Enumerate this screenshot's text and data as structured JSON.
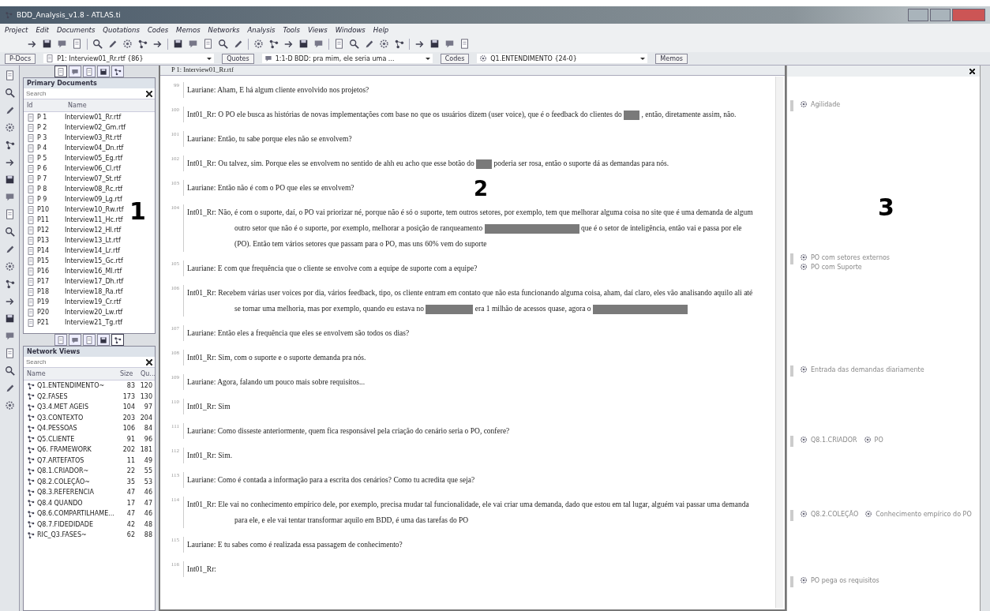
{
  "window": {
    "title": "BDD_Analysis_v1.8 - ATLAS.ti",
    "menu": [
      "Project",
      "Edit",
      "Documents",
      "Quotations",
      "Codes",
      "Memos",
      "Networks",
      "Analysis",
      "Tools",
      "Views",
      "Windows",
      "Help"
    ]
  },
  "selector_bar": [
    {
      "kind": "button",
      "label": "P-Docs"
    },
    {
      "kind": "combo",
      "value": "P1: Interview01_Rr.rtf {86}"
    },
    {
      "kind": "button",
      "label": "Quotes"
    },
    {
      "kind": "combo",
      "value": "1:1-D BDD: pra mim, ele seria uma ..."
    },
    {
      "kind": "button",
      "label": "Codes"
    },
    {
      "kind": "combo",
      "value": "Q1.ENTENDIMENTO {24-0}"
    },
    {
      "kind": "button",
      "label": "Memos"
    }
  ],
  "primary_documents": {
    "title": "Primary Documents",
    "search_placeholder": "Search",
    "columns": [
      "Id",
      "Name"
    ],
    "rows": [
      {
        "id": "P 1",
        "name": "Interview01_Rr.rtf"
      },
      {
        "id": "P 2",
        "name": "Interview02_Gm.rtf"
      },
      {
        "id": "P 3",
        "name": "Interview03_Rt.rtf"
      },
      {
        "id": "P 4",
        "name": "Interview04_Dn.rtf"
      },
      {
        "id": "P 5",
        "name": "Interview05_Eg.rtf"
      },
      {
        "id": "P 6",
        "name": "Interview06_Cl.rtf"
      },
      {
        "id": "P 7",
        "name": "Interview07_St.rtf"
      },
      {
        "id": "P 8",
        "name": "Interview08_Rc.rtf"
      },
      {
        "id": "P 9",
        "name": "Interview09_Lg.rtf"
      },
      {
        "id": "P10",
        "name": "Interview10_Rw.rtf"
      },
      {
        "id": "P11",
        "name": "Interview11_Hc.rtf"
      },
      {
        "id": "P12",
        "name": "Interview12_Hl.rtf"
      },
      {
        "id": "P13",
        "name": "Interview13_Lt.rtf"
      },
      {
        "id": "P14",
        "name": "Interview14_Lr.rtf"
      },
      {
        "id": "P15",
        "name": "Interview15_Gc.rtf"
      },
      {
        "id": "P16",
        "name": "Interview16_Ml.rtf"
      },
      {
        "id": "P17",
        "name": "Interview17_Dh.rtf"
      },
      {
        "id": "P18",
        "name": "Interview18_Ra.rtf"
      },
      {
        "id": "P19",
        "name": "Interview19_Cr.rtf"
      },
      {
        "id": "P20",
        "name": "Interview20_Lw.rtf"
      },
      {
        "id": "P21",
        "name": "Interview21_Tg.rtf"
      }
    ]
  },
  "network_views": {
    "title": "Network Views",
    "search_placeholder": "Search",
    "columns": [
      "Name",
      "Size",
      "Qu..."
    ],
    "rows": [
      {
        "name": "Q1.ENTENDIMENTO~",
        "size": "83",
        "column_3": "120"
      },
      {
        "name": "Q2.FASES",
        "size": "173",
        "column_3": "130"
      },
      {
        "name": "Q3.4.MET AGEIS",
        "size": "104",
        "column_3": "97"
      },
      {
        "name": "Q3.CONTEXTO",
        "size": "203",
        "column_3": "204"
      },
      {
        "name": "Q4.PESSOAS",
        "size": "106",
        "column_3": "84"
      },
      {
        "name": "Q5.CLIENTE",
        "size": "91",
        "column_3": "96"
      },
      {
        "name": "Q6. FRAMEWORK",
        "size": "202",
        "column_3": "181"
      },
      {
        "name": "Q7.ARTEFATOS",
        "size": "11",
        "column_3": "49"
      },
      {
        "name": "Q8.1.CRIADOR~",
        "size": "22",
        "column_3": "55"
      },
      {
        "name": "Q8.2.COLEÇÃO~",
        "size": "35",
        "column_3": "53"
      },
      {
        "name": "Q8.3.REFERENCIA",
        "size": "47",
        "column_3": "46"
      },
      {
        "name": "Q8.4 QUANDO",
        "size": "17",
        "column_3": "47"
      },
      {
        "name": "Q8.6.COMPARTILHAME...",
        "size": "47",
        "column_3": "46"
      },
      {
        "name": "Q8.7.FIDEDIDADE",
        "size": "42",
        "column_3": "48"
      },
      {
        "name": "RIC_Q3.FASES~",
        "size": "62",
        "column_3": "88"
      }
    ]
  },
  "document": {
    "title": "P 1: Interview01_Rr.rtf",
    "paragraphs": [
      {
        "number": "99",
        "segments": [
          {
            "kind": "text",
            "text": "Lauriane: Aham, E há algum cliente envolvido nos projetos?"
          }
        ]
      },
      {
        "number": "100",
        "segments": [
          {
            "kind": "text",
            "text": "Int01_Rr: O PO ele busca as histórias de novas implementações com base no que os usuários dizem (user voice), que é o feedback do clientes do"
          },
          {
            "kind": "short"
          },
          {
            "kind": "text",
            "text": ", então, diretamente assim, não."
          }
        ]
      },
      {
        "number": "101",
        "segments": [
          {
            "kind": "text",
            "text": "Lauriane: Então, tu sabe porque eles não se envolvem?"
          }
        ]
      },
      {
        "number": "102",
        "segments": [
          {
            "kind": "text",
            "text": "Int01_Rr: Ou talvez, sim. Porque eles se envolvem no sentido de ahh eu acho que esse botão do"
          },
          {
            "kind": "short"
          },
          {
            "kind": "text",
            "text": "poderia ser rosa, então o suporte dá as demandas para nós."
          }
        ]
      },
      {
        "number": "103",
        "segments": [
          {
            "kind": "text",
            "text": "Lauriane: Então não é com o PO que eles se envolvem?"
          }
        ]
      },
      {
        "number": "104",
        "segments": [
          {
            "kind": "text",
            "text": "Int01_Rr: Não, é com o suporte, daí, o PO vai priorizar né, porque não é só o suporte, tem outros setores, por exemplo, tem que melhorar alguma coisa no site que é uma demanda de algum outro setor que não é o suporte, por exemplo, melhorar a posição de ranqueamento"
          },
          {
            "kind": "long"
          },
          {
            "kind": "text",
            "text": "que é o setor de inteligência, então vai e passa por ele (PO). Então tem vários setores que passam para o PO, mas uns 60% vem do suporte"
          }
        ]
      },
      {
        "number": "105",
        "segments": [
          {
            "kind": "text",
            "text": "Lauriane: E com que frequência que o cliente se envolve com a equipe de suporte com a equipe?"
          }
        ]
      },
      {
        "number": "106",
        "segments": [
          {
            "kind": "text",
            "text": "Int01_Rr: Recebem várias user voices por dia, vários feedback, tipo, os cliente entram em contato que não esta funcionando alguma coisa, aham, daí claro, eles vão analisando aquilo ali até se tornar uma melhoria, mas por exemplo, quando eu estava no"
          },
          {
            "kind": "medium"
          },
          {
            "kind": "text",
            "text": "era 1 milhão de acessos quase, agora o"
          },
          {
            "kind": "long"
          }
        ]
      },
      {
        "number": "107",
        "segments": [
          {
            "kind": "text",
            "text": "Lauriane: Então eles a frequência que eles se envolvem são todos os dias?"
          }
        ]
      },
      {
        "number": "108",
        "segments": [
          {
            "kind": "text",
            "text": "Int01_Rr: Sim, com o suporte e o suporte demanda pra nós."
          }
        ]
      },
      {
        "number": "109",
        "segments": [
          {
            "kind": "text",
            "text": "Lauriane: Agora, falando um pouco mais sobre requisitos..."
          }
        ]
      },
      {
        "number": "110",
        "segments": [
          {
            "kind": "text",
            "text": "Int01_Rr: Sim"
          }
        ]
      },
      {
        "number": "111",
        "segments": [
          {
            "kind": "text",
            "text": "Lauriane: Como disseste anteriormente, quem fica responsável pela criação do cenário seria o PO, confere?"
          }
        ]
      },
      {
        "number": "112",
        "segments": [
          {
            "kind": "text",
            "text": "Int01_Rr: Sim."
          }
        ]
      },
      {
        "number": "113",
        "segments": [
          {
            "kind": "text",
            "text": "Lauriane: Como é contada a informação para a escrita dos cenários? Como tu acredita que seja?"
          }
        ]
      },
      {
        "number": "114",
        "segments": [
          {
            "kind": "text",
            "text": "Int01_Rr: Ele vai no conhecimento empírico dele, por exemplo, precisa mudar tal funcionalidade, ele vai criar uma demanda, dado que estou em tal lugar, alguém vai passar uma demanda para ele, e ele vai tentar transformar aquilo em BDD, é uma das tarefas do PO"
          }
        ]
      },
      {
        "number": "115",
        "segments": [
          {
            "kind": "text",
            "text": "Lauriane: E tu sabes como é realizada essa passagem de conhecimento?"
          }
        ]
      },
      {
        "number": "116",
        "segments": [
          {
            "kind": "text",
            "text": "Int01_Rr:"
          }
        ]
      }
    ]
  },
  "margin_codes": [
    {
      "codes": [
        "Agilidade"
      ]
    },
    {
      "codes": [
        "PO com setores externos",
        "PO com Suporte"
      ]
    },
    {
      "codes": [
        "Entrada das demandas diariamente"
      ]
    },
    {
      "codes": [
        "Q8.1.CRIADOR",
        "PO"
      ]
    },
    {
      "codes": [
        "Q8.2.COLEÇÃO",
        "Conhecimento empírico do PO"
      ]
    },
    {
      "codes": [
        "PO pega os requisitos"
      ]
    }
  ],
  "annotations": [
    "1",
    "2",
    "3"
  ]
}
